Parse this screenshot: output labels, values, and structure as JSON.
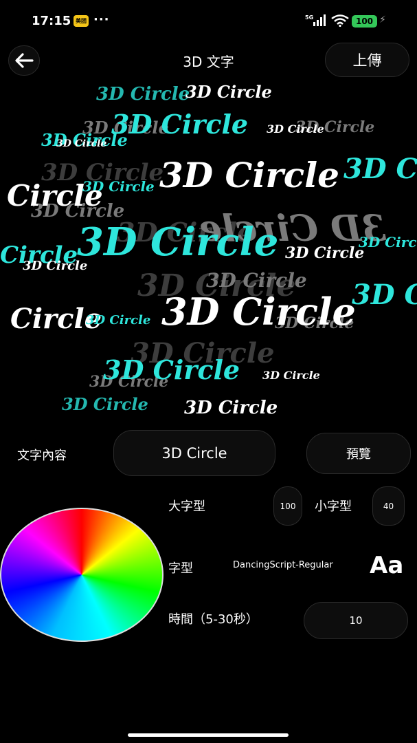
{
  "status_bar": {
    "time": "17:15",
    "app_badge": "美团",
    "more": "···",
    "network": "5G",
    "battery": "100"
  },
  "header": {
    "title": "3D 文字",
    "upload_label": "上傳"
  },
  "sphere": {
    "word": "3D Circle",
    "edge_word": "Circle",
    "accent_color": "#2ee6dc"
  },
  "controls": {
    "text_label": "文字內容",
    "text_value": "3D Circle",
    "preview_label": "預覽",
    "large_font_label": "大字型",
    "large_font_value": "100",
    "small_font_label": "小字型",
    "small_font_value": "40",
    "font_label": "字型",
    "font_name": "DancingScript-Regular",
    "font_icon": "Aa",
    "time_label": "時間（5-30秒）",
    "time_value": "10"
  }
}
